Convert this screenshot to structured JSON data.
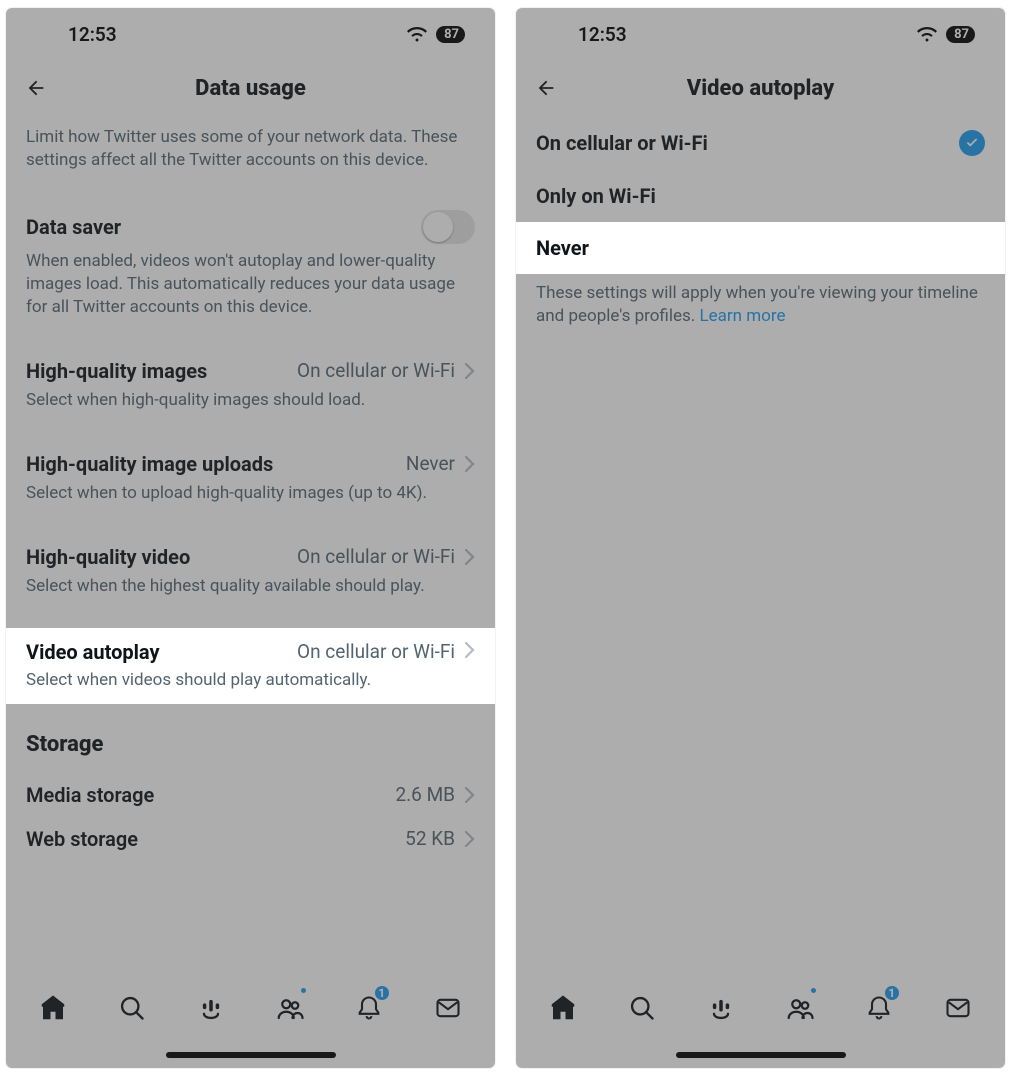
{
  "status": {
    "time": "12:53",
    "battery": "87"
  },
  "screen1": {
    "title": "Data usage",
    "intro": "Limit how Twitter uses some of your network data. These settings affect all the Twitter accounts on this device.",
    "datasaver": {
      "label": "Data saver",
      "desc": "When enabled, videos won't autoplay and lower-quality images load. This automatically reduces your data usage for all Twitter accounts on this device."
    },
    "hqimages": {
      "label": "High-quality images",
      "value": "On cellular or Wi-Fi",
      "desc": "Select when high-quality images should load."
    },
    "hqupload": {
      "label": "High-quality image uploads",
      "value": "Never",
      "desc": "Select when to upload high-quality images (up to 4K)."
    },
    "hqvideo": {
      "label": "High-quality video",
      "value": "On cellular or Wi-Fi",
      "desc": "Select when the highest quality available should play."
    },
    "autoplay": {
      "label": "Video autoplay",
      "value": "On cellular or Wi-Fi",
      "desc": "Select when videos should play automatically."
    },
    "storage_header": "Storage",
    "media": {
      "label": "Media storage",
      "value": "2.6 MB"
    },
    "web": {
      "label": "Web storage",
      "value": "52 KB"
    }
  },
  "screen2": {
    "title": "Video autoplay",
    "opt1": "On cellular or Wi-Fi",
    "opt2": "Only on Wi-Fi",
    "opt3": "Never",
    "footnote": "These settings will apply when you're viewing your timeline and people's profiles. ",
    "learnmore": "Learn more"
  },
  "tabs": {
    "notif_badge": "1"
  }
}
